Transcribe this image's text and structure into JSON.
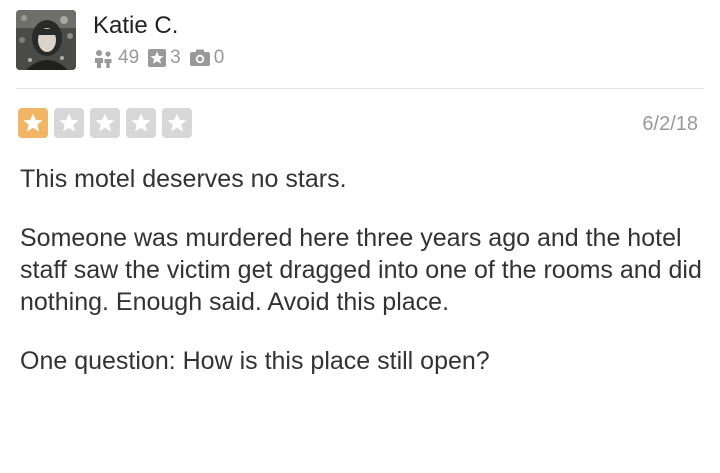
{
  "user": {
    "name": "Katie C.",
    "friends_count": "49",
    "reviews_count": "3",
    "photos_count": "0",
    "friends_icon": "friends-icon",
    "reviews_icon": "review-star-icon",
    "photos_icon": "camera-icon"
  },
  "review": {
    "rating": 1,
    "max_rating": 5,
    "date": "6/2/18",
    "paragraphs": [
      "This motel deserves no stars.",
      "Someone was murdered here three years ago and the hotel staff saw the victim get dragged into one of the rooms and did nothing. Enough said. Avoid this place.",
      "One question: How is this place still open?"
    ]
  },
  "colors": {
    "star_filled": "#f0b665",
    "star_empty": "#d7d7d7",
    "text": "#333333",
    "muted": "#999999"
  }
}
